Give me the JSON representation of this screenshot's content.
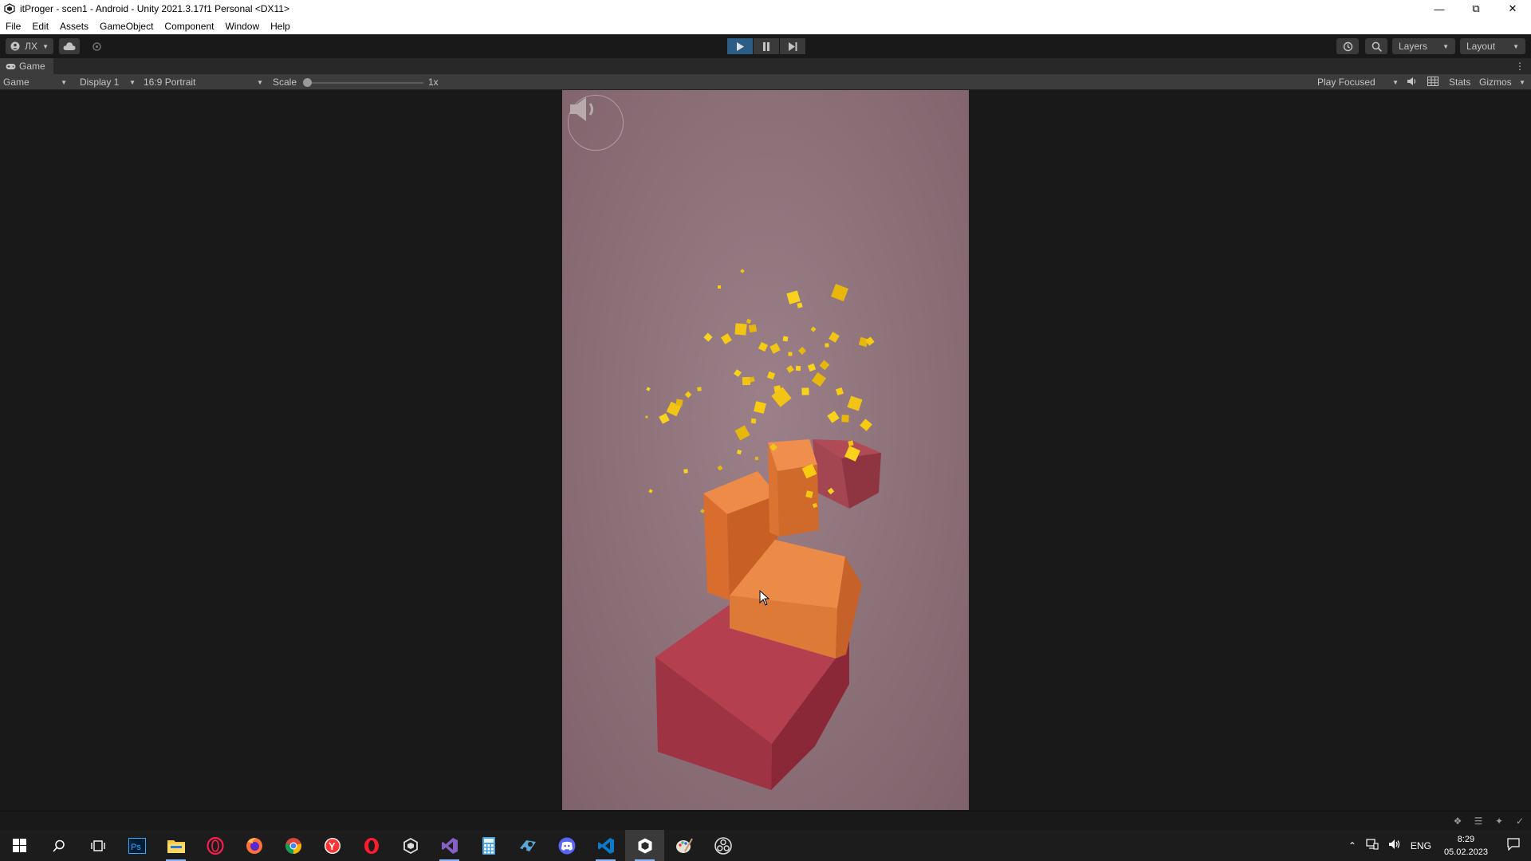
{
  "window": {
    "title": "itProger - scen1 - Android - Unity 2021.3.17f1 Personal <DX11>"
  },
  "menu": [
    "File",
    "Edit",
    "Assets",
    "GameObject",
    "Component",
    "Window",
    "Help"
  ],
  "toolbar": {
    "account_label": "ЛХ",
    "layers_label": "Layers",
    "layout_label": "Layout"
  },
  "game_tab": {
    "label": "Game"
  },
  "game_controls": {
    "view_mode": "Game",
    "display": "Display 1",
    "aspect": "16:9 Portrait",
    "scale_label": "Scale",
    "scale_value": "1x",
    "scale_fraction": 0.0,
    "play_mode": "Play Focused",
    "stats_label": "Stats",
    "gizmos_label": "Gizmos"
  },
  "play_state": {
    "playing": true,
    "paused": false
  },
  "taskbar": {
    "apps": [
      "start-icon",
      "search-icon",
      "task-view-icon",
      "photoshop-icon",
      "file-explorer-icon",
      "opera-gx-icon",
      "firefox-icon",
      "chrome-icon",
      "yandex-browser-icon",
      "opera-icon",
      "unity-hub-icon",
      "visual-studio-icon",
      "calculator-icon",
      "steam-icon",
      "discord-icon",
      "vscode-icon",
      "unity-icon",
      "paint-icon",
      "obs-icon"
    ],
    "language": "ENG",
    "time": "8:29",
    "date": "05.02.2023"
  },
  "colors": {
    "play_active": "#2c5d87",
    "game_bg": "#8c7078",
    "tower_base": "#a33445",
    "tower_orange": "#e8803f",
    "particles": "#f5c518"
  }
}
